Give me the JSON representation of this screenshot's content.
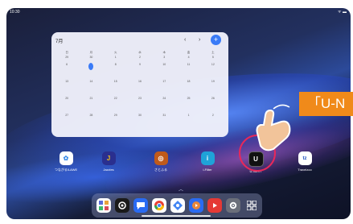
{
  "status": {
    "time": "10:30",
    "icons": "ᯤ ▬"
  },
  "calendar": {
    "month": "7月",
    "prev": "‹",
    "next": "›",
    "add": "+",
    "weekdays": [
      {
        "kanji": "日",
        "num": "29"
      },
      {
        "kanji": "月",
        "num": "30"
      },
      {
        "kanji": "火",
        "num": "1"
      },
      {
        "kanji": "水",
        "num": "2"
      },
      {
        "kanji": "木",
        "num": "3"
      },
      {
        "kanji": "金",
        "num": "4"
      },
      {
        "kanji": "土",
        "num": "5"
      }
    ],
    "weeks": [
      [
        "6",
        "",
        "8",
        "9",
        "10",
        "11",
        "12"
      ],
      [
        "13",
        "14",
        "15",
        "16",
        "17",
        "18",
        "19"
      ],
      [
        "20",
        "21",
        "22",
        "23",
        "24",
        "25",
        "26"
      ],
      [
        "27",
        "28",
        "29",
        "30",
        "31",
        "1",
        "2"
      ]
    ]
  },
  "apps": [
    {
      "label": "つながる!LAWE",
      "icon": "tsunagaru-icon",
      "color": "#ffffff",
      "glyph": "✿"
    },
    {
      "label": "Jazzles",
      "icon": "jazzles-icon",
      "color": "#2a2f8f",
      "glyph": "J"
    },
    {
      "label": "さとふる",
      "icon": "satofuru-icon",
      "color": "#c05a1a",
      "glyph": "◎"
    },
    {
      "label": "i-Filter",
      "icon": "ifilter-icon",
      "color": "#1fa3d8",
      "glyph": "i"
    },
    {
      "label": "U-NEXT",
      "icon": "unext-icon",
      "color": "#111111",
      "glyph": "U"
    },
    {
      "label": "Travelzoo",
      "icon": "travelzoo-icon",
      "color": "#ffffff",
      "glyph": "tz"
    }
  ],
  "banner": {
    "text": "「U-N"
  },
  "taskbar_icons": [
    "app-grid-icon",
    "camera-icon",
    "chat-icon",
    "chrome-icon",
    "photos-icon",
    "youtube-icon",
    "play-icon",
    "settings-icon",
    "apps-icon"
  ]
}
